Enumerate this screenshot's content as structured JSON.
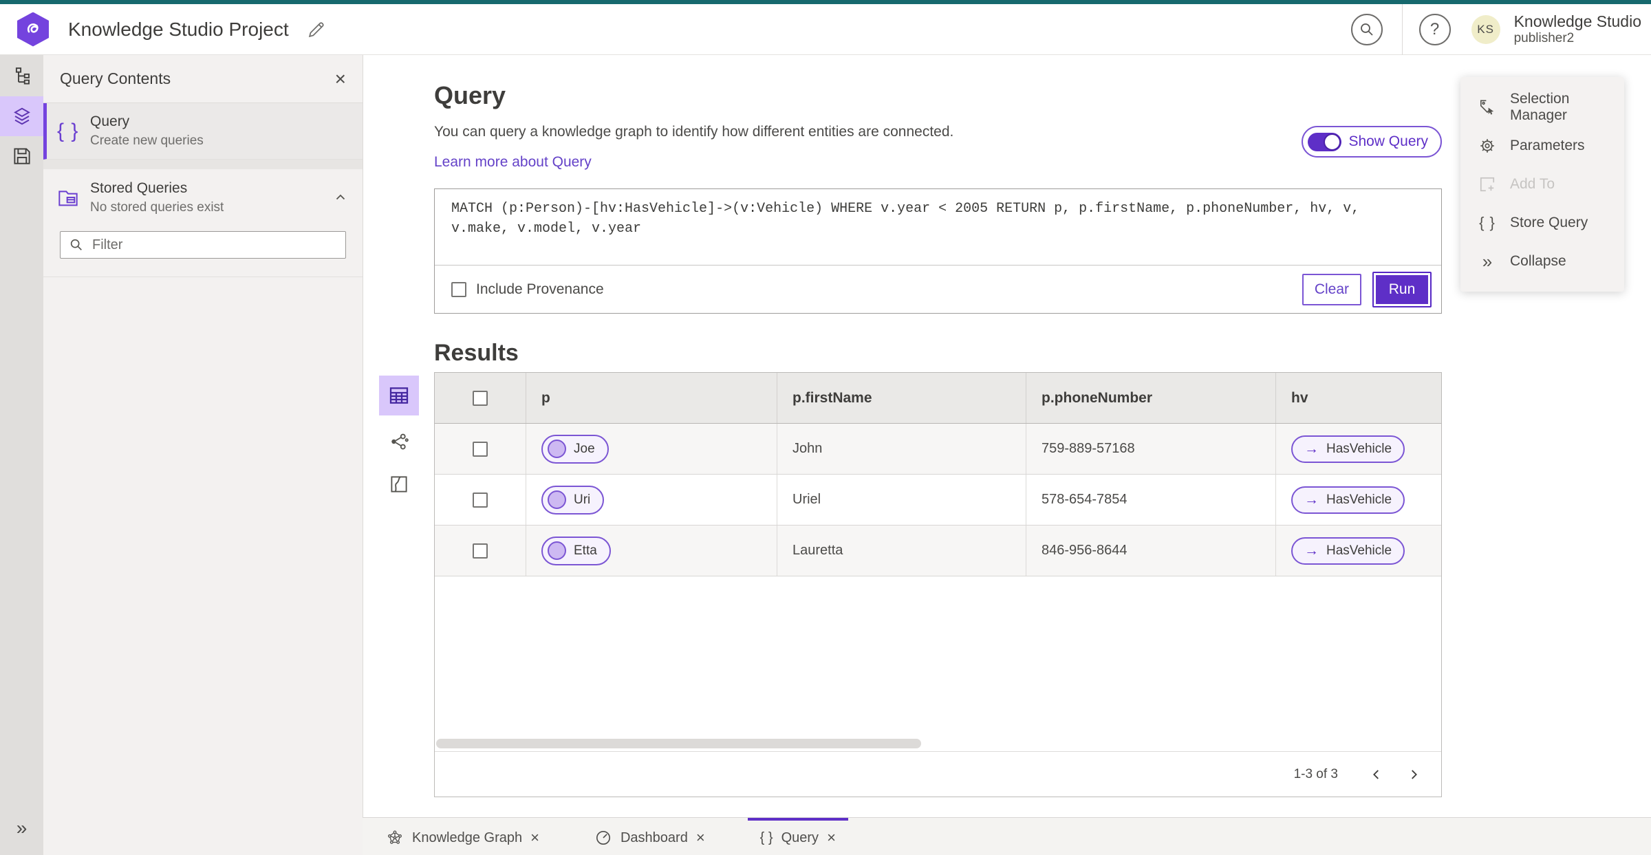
{
  "colors": {
    "topbar_teal": "#17696E",
    "accent_purple": "#5E2FC7",
    "accent_purple_light": "#D9C7FB",
    "link_purple": "#6442C8",
    "pill_border_purple": "#7B55D4"
  },
  "icons": {
    "braces": "{ }",
    "double_chevron_right": "»",
    "hv_arrow": "→",
    "close": "×",
    "help": "?"
  },
  "header": {
    "project_title": "Knowledge Studio Project",
    "app_name": "Knowledge Studio",
    "user_name": "publisher2",
    "avatar_initials": "KS"
  },
  "left_panel": {
    "title": "Query Contents",
    "query_item": {
      "title": "Query",
      "subtitle": "Create new queries"
    },
    "stored_queries": {
      "title": "Stored Queries",
      "subtitle": "No stored queries exist"
    },
    "filter_placeholder": "Filter"
  },
  "query_section": {
    "heading": "Query",
    "description": "You can query a knowledge graph to identify how different entities are connected.",
    "learn_more_link": "Learn more about Query",
    "show_query_label": "Show Query",
    "query_text": "MATCH (p:Person)-[hv:HasVehicle]->(v:Vehicle) WHERE v.year < 2005 RETURN p, p.firstName, p.phoneNumber, hv, v, v.make, v.model, v.year",
    "include_provenance_label": "Include Provenance",
    "clear_button": "Clear",
    "run_button": "Run"
  },
  "results": {
    "heading": "Results",
    "columns": [
      "p",
      "p.firstName",
      "p.phoneNumber",
      "hv"
    ],
    "rows": [
      {
        "p": "Joe",
        "firstName": "John",
        "phoneNumber": "759-889-57168",
        "hv": "HasVehicle"
      },
      {
        "p": "Uri",
        "firstName": "Uriel",
        "phoneNumber": "578-654-7854",
        "hv": "HasVehicle"
      },
      {
        "p": "Etta",
        "firstName": "Lauretta",
        "phoneNumber": "846-956-8644",
        "hv": "HasVehicle"
      }
    ],
    "pagination_label": "1-3 of 3"
  },
  "right_panel": {
    "items": [
      {
        "label": "Selection Manager"
      },
      {
        "label": "Parameters"
      },
      {
        "label": "Add To",
        "disabled": true
      },
      {
        "label": "Store Query"
      },
      {
        "label": "Collapse"
      }
    ]
  },
  "tabs": [
    {
      "label": "Knowledge Graph"
    },
    {
      "label": "Dashboard"
    },
    {
      "label": "Query",
      "active": true
    }
  ]
}
